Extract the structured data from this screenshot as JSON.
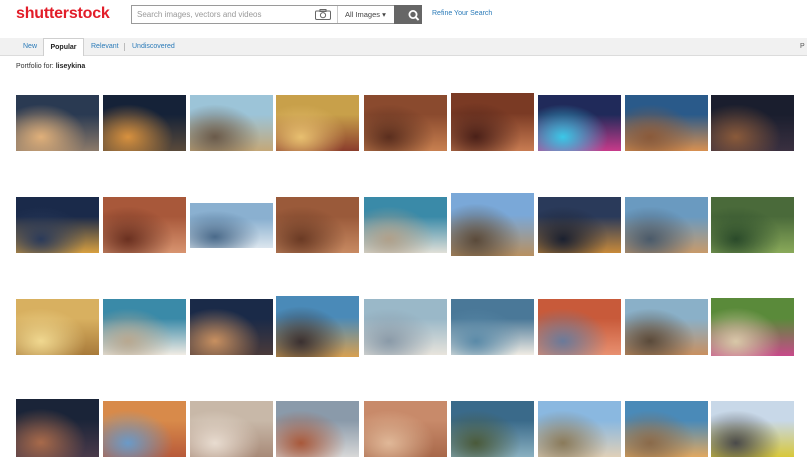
{
  "header": {
    "logo_text": "shutterstock",
    "search_placeholder": "Search images, vectors and videos",
    "filter_label": "All Images ▾",
    "refine_label": "Refine Your Search"
  },
  "tabs": [
    {
      "label": "New",
      "active": false
    },
    {
      "label": "Popular",
      "active": true
    },
    {
      "label": "Relevant",
      "active": false
    },
    {
      "label": "Undiscovered",
      "active": false
    }
  ],
  "tabbar_right_cut": "P",
  "portfolio": {
    "prefix": "Portfolio for: ",
    "name": "liseykina"
  },
  "colors": {
    "brand": "#e21d29",
    "link": "#2a7ab8",
    "search_button": "#666666"
  },
  "icons": {
    "camera": "camera-icon",
    "search": "search-icon"
  },
  "thumbnails": [
    [
      {
        "name": "city-reflection",
        "colors": [
          "#2a3a52",
          "#8c7a6a",
          "#e0b07a"
        ]
      },
      {
        "name": "milky-way-desert",
        "colors": [
          "#152238",
          "#5a4a3a",
          "#d8913e"
        ]
      },
      {
        "name": "plaza-sunrise",
        "colors": [
          "#9cc4d8",
          "#c4a878",
          "#6a5a4a"
        ]
      },
      {
        "name": "colorful-street",
        "colors": [
          "#c8a04a",
          "#8a3c2c",
          "#e8c070"
        ]
      },
      {
        "name": "canyon-petra",
        "colors": [
          "#8a4a2e",
          "#c88050",
          "#5a2e1e"
        ]
      },
      {
        "name": "treasury-petra",
        "colors": [
          "#7a3a24",
          "#c87c52",
          "#4a2018"
        ]
      },
      {
        "name": "tokyo-night",
        "colors": [
          "#202a5a",
          "#c83a8a",
          "#3ac8e8"
        ]
      },
      {
        "name": "desert-balloons",
        "colors": [
          "#2a5a8a",
          "#d89050",
          "#8a5a3a"
        ]
      },
      {
        "name": "night-desert",
        "colors": [
          "#1a1e2e",
          "#3a3040",
          "#8a5a3a"
        ]
      }
    ],
    [
      {
        "name": "night-coast-city",
        "colors": [
          "#1a2a4a",
          "#d8a040",
          "#2a3a5a"
        ]
      },
      {
        "name": "red-rock-tomb",
        "colors": [
          "#a8583a",
          "#d89470",
          "#6a3020"
        ]
      },
      {
        "name": "modern-towers",
        "colors": [
          "#8ab0d0",
          "#dce6ee",
          "#4a6a8a"
        ]
      },
      {
        "name": "petra-carving",
        "colors": [
          "#9a5a3a",
          "#c88a62",
          "#6a3a24"
        ]
      },
      {
        "name": "salt-shore",
        "colors": [
          "#3a8aa8",
          "#e0e0d8",
          "#b0a08a"
        ]
      },
      {
        "name": "old-town-street",
        "colors": [
          "#7aa8d8",
          "#b89060",
          "#5a4a3a"
        ]
      },
      {
        "name": "evening-city",
        "colors": [
          "#2a3a5a",
          "#c88a3a",
          "#1a2030"
        ]
      },
      {
        "name": "hill-town",
        "colors": [
          "#6a9ac0",
          "#c89a6a",
          "#4a5a6a"
        ]
      },
      {
        "name": "green-valley",
        "colors": [
          "#4a6a3a",
          "#8aaa5a",
          "#2a4a2a"
        ]
      }
    ],
    [
      {
        "name": "golden-city",
        "colors": [
          "#d8b060",
          "#a87a3a",
          "#f0d890"
        ]
      },
      {
        "name": "salt-crystals",
        "colors": [
          "#3a8aa8",
          "#f0ece4",
          "#b8a890"
        ]
      },
      {
        "name": "milky-way-rocks",
        "colors": [
          "#1a2a48",
          "#4a3a3a",
          "#c89060"
        ]
      },
      {
        "name": "cathedral-sunset",
        "colors": [
          "#4a8ab8",
          "#d8a050",
          "#3a3030"
        ]
      },
      {
        "name": "salt-formations",
        "colors": [
          "#9ab8c8",
          "#e8e4dc",
          "#8a9aa8"
        ]
      },
      {
        "name": "salt-pillar",
        "colors": [
          "#4a7898",
          "#f0ece4",
          "#5a8aa8"
        ]
      },
      {
        "name": "red-desert-rocks",
        "colors": [
          "#c85a3a",
          "#e89070",
          "#6a7a9a"
        ]
      },
      {
        "name": "balloon-valley",
        "colors": [
          "#8ab0c8",
          "#c89060",
          "#5a4a3a"
        ]
      },
      {
        "name": "flower-house",
        "colors": [
          "#5a8a3a",
          "#c84a8a",
          "#d8c8a8"
        ]
      }
    ],
    [
      {
        "name": "monument-night",
        "colors": [
          "#1a2438",
          "#4a3a4a",
          "#a86a4a"
        ]
      },
      {
        "name": "warm-street",
        "colors": [
          "#d88a4a",
          "#b85a3a",
          "#6a9ac8"
        ]
      },
      {
        "name": "cave-room",
        "colors": [
          "#c8b8a8",
          "#a88a78",
          "#e8dcd0"
        ]
      },
      {
        "name": "cloudy-desert",
        "colors": [
          "#8a9aaa",
          "#d8d8d8",
          "#a8583a"
        ]
      },
      {
        "name": "camel-petra",
        "colors": [
          "#c88a6a",
          "#a8684a",
          "#e0b898"
        ]
      },
      {
        "name": "aerial-roads",
        "colors": [
          "#3a6a8a",
          "#8ab0c0",
          "#4a5a3a"
        ]
      },
      {
        "name": "fairy-chimneys",
        "colors": [
          "#8ab8e0",
          "#e0d0b8",
          "#8a7a5a"
        ]
      },
      {
        "name": "balloon-horizon",
        "colors": [
          "#4a8ab8",
          "#e0a860",
          "#8a6a4a"
        ]
      },
      {
        "name": "tram-street",
        "colors": [
          "#c8d8e8",
          "#d8c83a",
          "#4a4a4a"
        ]
      }
    ]
  ]
}
